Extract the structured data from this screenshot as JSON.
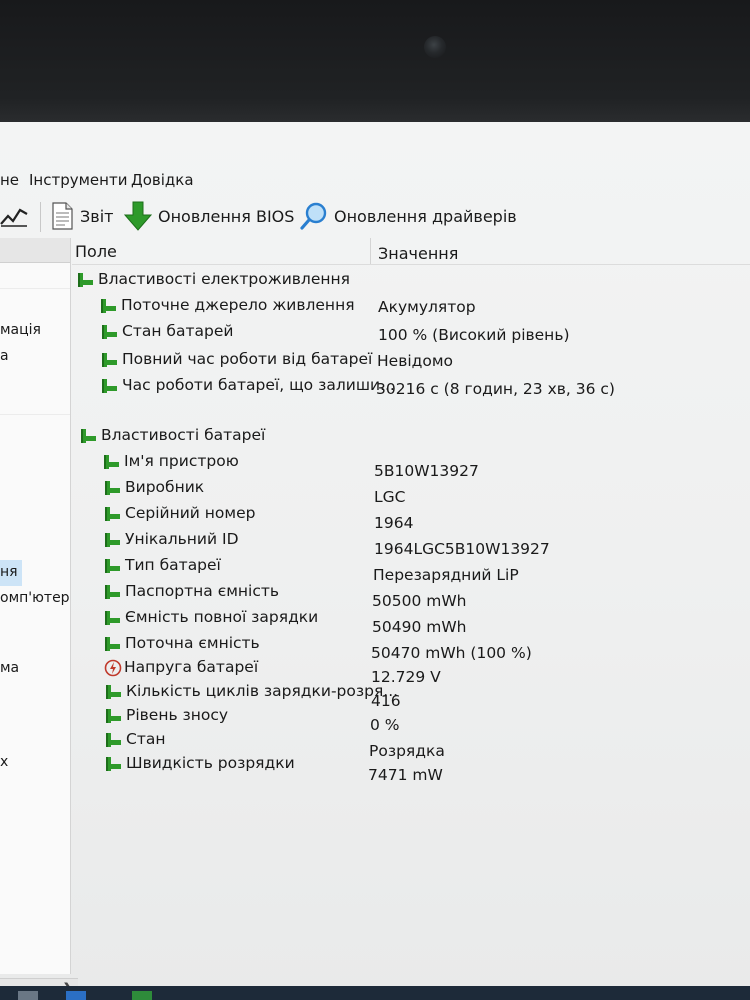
{
  "menu": {
    "items": [
      "не",
      "Інструменти",
      "Довідка"
    ]
  },
  "toolbar": {
    "report_label": "Звіт",
    "bios_update_label": "Оновлення BIOS",
    "driver_update_label": "Оновлення драйверів"
  },
  "sidebar": {
    "items": [
      {
        "label": "мація"
      },
      {
        "label": "а"
      },
      {
        "label": "ня"
      },
      {
        "label": "омп'ютер"
      },
      {
        "label": "ма"
      },
      {
        "label": "х"
      }
    ]
  },
  "table": {
    "col_field": "Поле",
    "col_value": "Значення",
    "group_power": "Властивості електроживлення",
    "power_rows": [
      {
        "field": "Поточне джерело живлення",
        "value": "Акумулятор"
      },
      {
        "field": "Стан батарей",
        "value": "100 % (Високий рівень)"
      },
      {
        "field": "Повний час роботи від батареї",
        "value": "Невідомо"
      },
      {
        "field": "Час роботи батареї, що залиши...",
        "value": "30216 с (8 годин, 23 хв, 36 с)"
      }
    ],
    "group_battery": "Властивості батареї",
    "battery_rows": [
      {
        "field": "Ім'я пристрою",
        "value": "5B10W13927"
      },
      {
        "field": "Виробник",
        "value": "LGC"
      },
      {
        "field": "Серійний номер",
        "value": "1964"
      },
      {
        "field": "Унікальний ID",
        "value": "1964LGC5B10W13927"
      },
      {
        "field": "Тип батареї",
        "value": "Перезарядний LiP"
      },
      {
        "field": "Паспортна ємність",
        "value": "50500 mWh"
      },
      {
        "field": "Ємність повної зарядки",
        "value": "50490 mWh"
      },
      {
        "field": "Поточна ємність",
        "value": "50470 mWh  (100 %)"
      },
      {
        "field": "Напруга батареї",
        "value": "12.729 V"
      },
      {
        "field": "Кількість циклів зарядки-розря...",
        "value": "416"
      },
      {
        "field": "Рівень зносу",
        "value": "0 %"
      },
      {
        "field": "Стан",
        "value": "Розрядка"
      },
      {
        "field": "Швидкість розрядки",
        "value": "7471 mW"
      }
    ]
  },
  "colors": {
    "accent_green": "#2e9a2a",
    "select_blue": "#cde4f7",
    "taskbar": "#1d2a39"
  },
  "icons": {
    "row_icon": "battery-item-icon",
    "voltage_icon": "voltage-icon",
    "report_icon": "document-icon",
    "bios_icon": "green-down-arrow-icon",
    "driver_icon": "magnifier-icon"
  }
}
